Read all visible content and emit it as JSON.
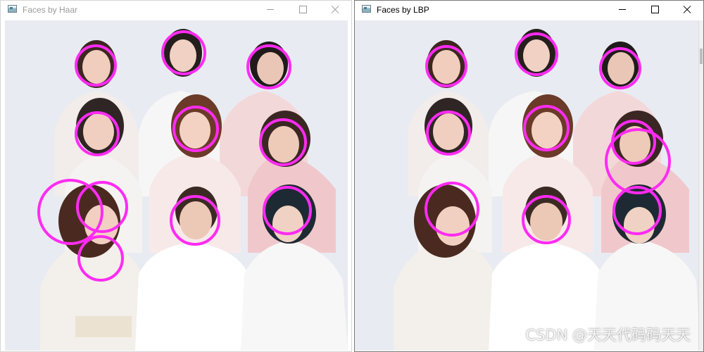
{
  "windows": {
    "haar": {
      "title": "Faces by Haar"
    },
    "lbp": {
      "title": "Faces by LBP"
    }
  },
  "watermark": "CSDN @天天代码码天天",
  "colors": {
    "detection_circle": "#ff2bf2",
    "backdrop": "#e9ebf2",
    "inactive_title": "#9a9a9a",
    "active_title": "#000000"
  },
  "icons": {
    "app": "opencv-window-icon",
    "minimize": "minimize-icon",
    "maximize": "maximize-icon",
    "close": "close-icon"
  }
}
